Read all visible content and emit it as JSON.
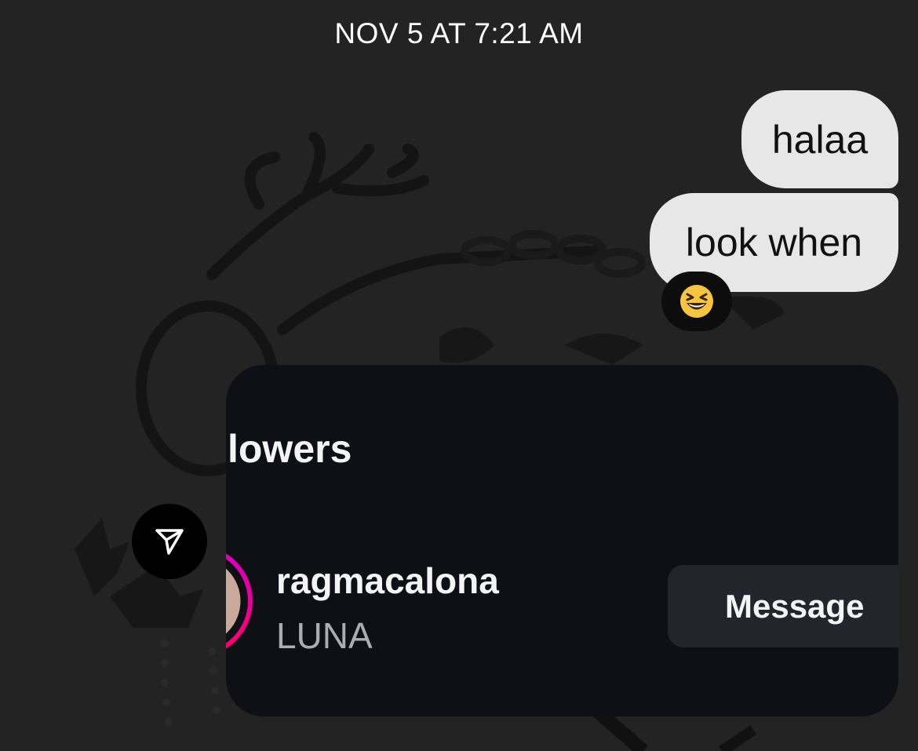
{
  "timestamp": "NOV 5 AT 7:21 AM",
  "messages": [
    {
      "text": "halaa"
    },
    {
      "text": "look when"
    }
  ],
  "reaction": {
    "emoji": "😆",
    "icon": "grinning-squinting-face-icon"
  },
  "shared_card": {
    "heading": "lowers",
    "username": "ragmacalona",
    "fullname": "LUNA",
    "button_label": "Message"
  },
  "share_icon": "send-paper-plane-icon",
  "colors": {
    "background": "#232323",
    "bubble": "#e7e7e7",
    "card": "#0e1015",
    "button": "#22252b",
    "ring_start": "#d300c5",
    "ring_end": "#ff0069"
  }
}
